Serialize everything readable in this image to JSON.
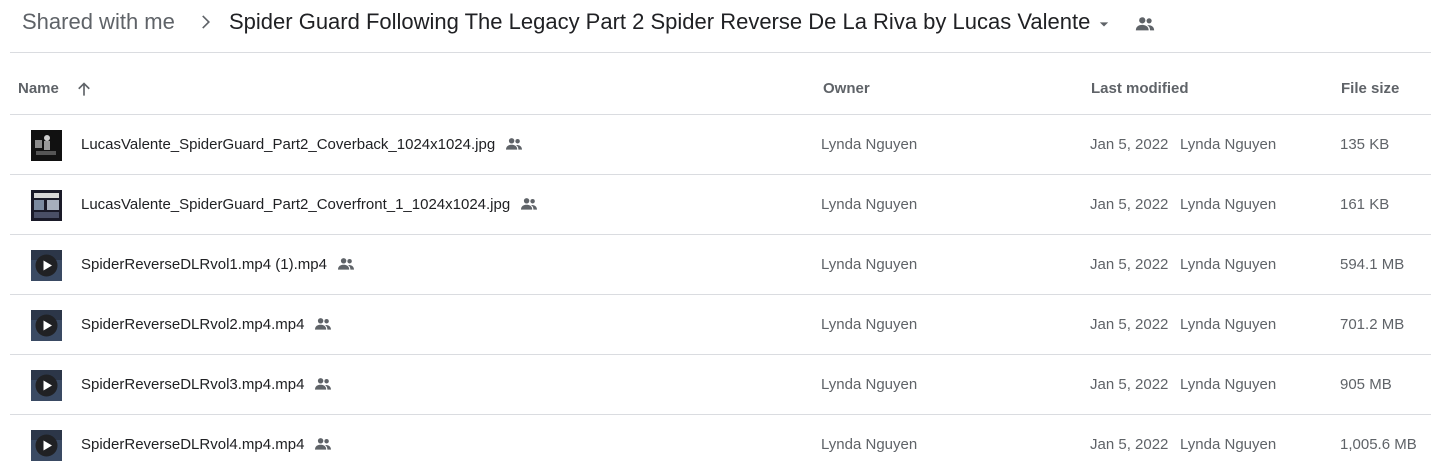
{
  "breadcrumb": {
    "root": "Shared with me",
    "current": "Spider Guard Following The Legacy Part 2 Spider Reverse De La Riva by Lucas Valente"
  },
  "table": {
    "headers": {
      "name": "Name",
      "owner": "Owner",
      "last_modified": "Last modified",
      "file_size": "File size"
    },
    "sort": "ascending",
    "rows": [
      {
        "name": "LucasValente_SpiderGuard_Part2_Coverback_1024x1024.jpg",
        "type": "image",
        "owner": "Lynda Nguyen",
        "modified_date": "Jan 5, 2022",
        "modified_by": "Lynda Nguyen",
        "size": "135 KB"
      },
      {
        "name": "LucasValente_SpiderGuard_Part2_Coverfront_1_1024x1024.jpg",
        "type": "image",
        "owner": "Lynda Nguyen",
        "modified_date": "Jan 5, 2022",
        "modified_by": "Lynda Nguyen",
        "size": "161 KB"
      },
      {
        "name": "SpiderReverseDLRvol1.mp4 (1).mp4",
        "type": "video",
        "owner": "Lynda Nguyen",
        "modified_date": "Jan 5, 2022",
        "modified_by": "Lynda Nguyen",
        "size": "594.1 MB"
      },
      {
        "name": "SpiderReverseDLRvol2.mp4.mp4",
        "type": "video",
        "owner": "Lynda Nguyen",
        "modified_date": "Jan 5, 2022",
        "modified_by": "Lynda Nguyen",
        "size": "701.2 MB"
      },
      {
        "name": "SpiderReverseDLRvol3.mp4.mp4",
        "type": "video",
        "owner": "Lynda Nguyen",
        "modified_date": "Jan 5, 2022",
        "modified_by": "Lynda Nguyen",
        "size": "905 MB"
      },
      {
        "name": "SpiderReverseDLRvol4.mp4.mp4",
        "type": "video",
        "owner": "Lynda Nguyen",
        "modified_date": "Jan 5, 2022",
        "modified_by": "Lynda Nguyen",
        "size": "1,005.6 MB"
      }
    ]
  },
  "colors": {
    "text_primary": "#202124",
    "text_secondary": "#5f6368",
    "divider": "#dadce0"
  }
}
